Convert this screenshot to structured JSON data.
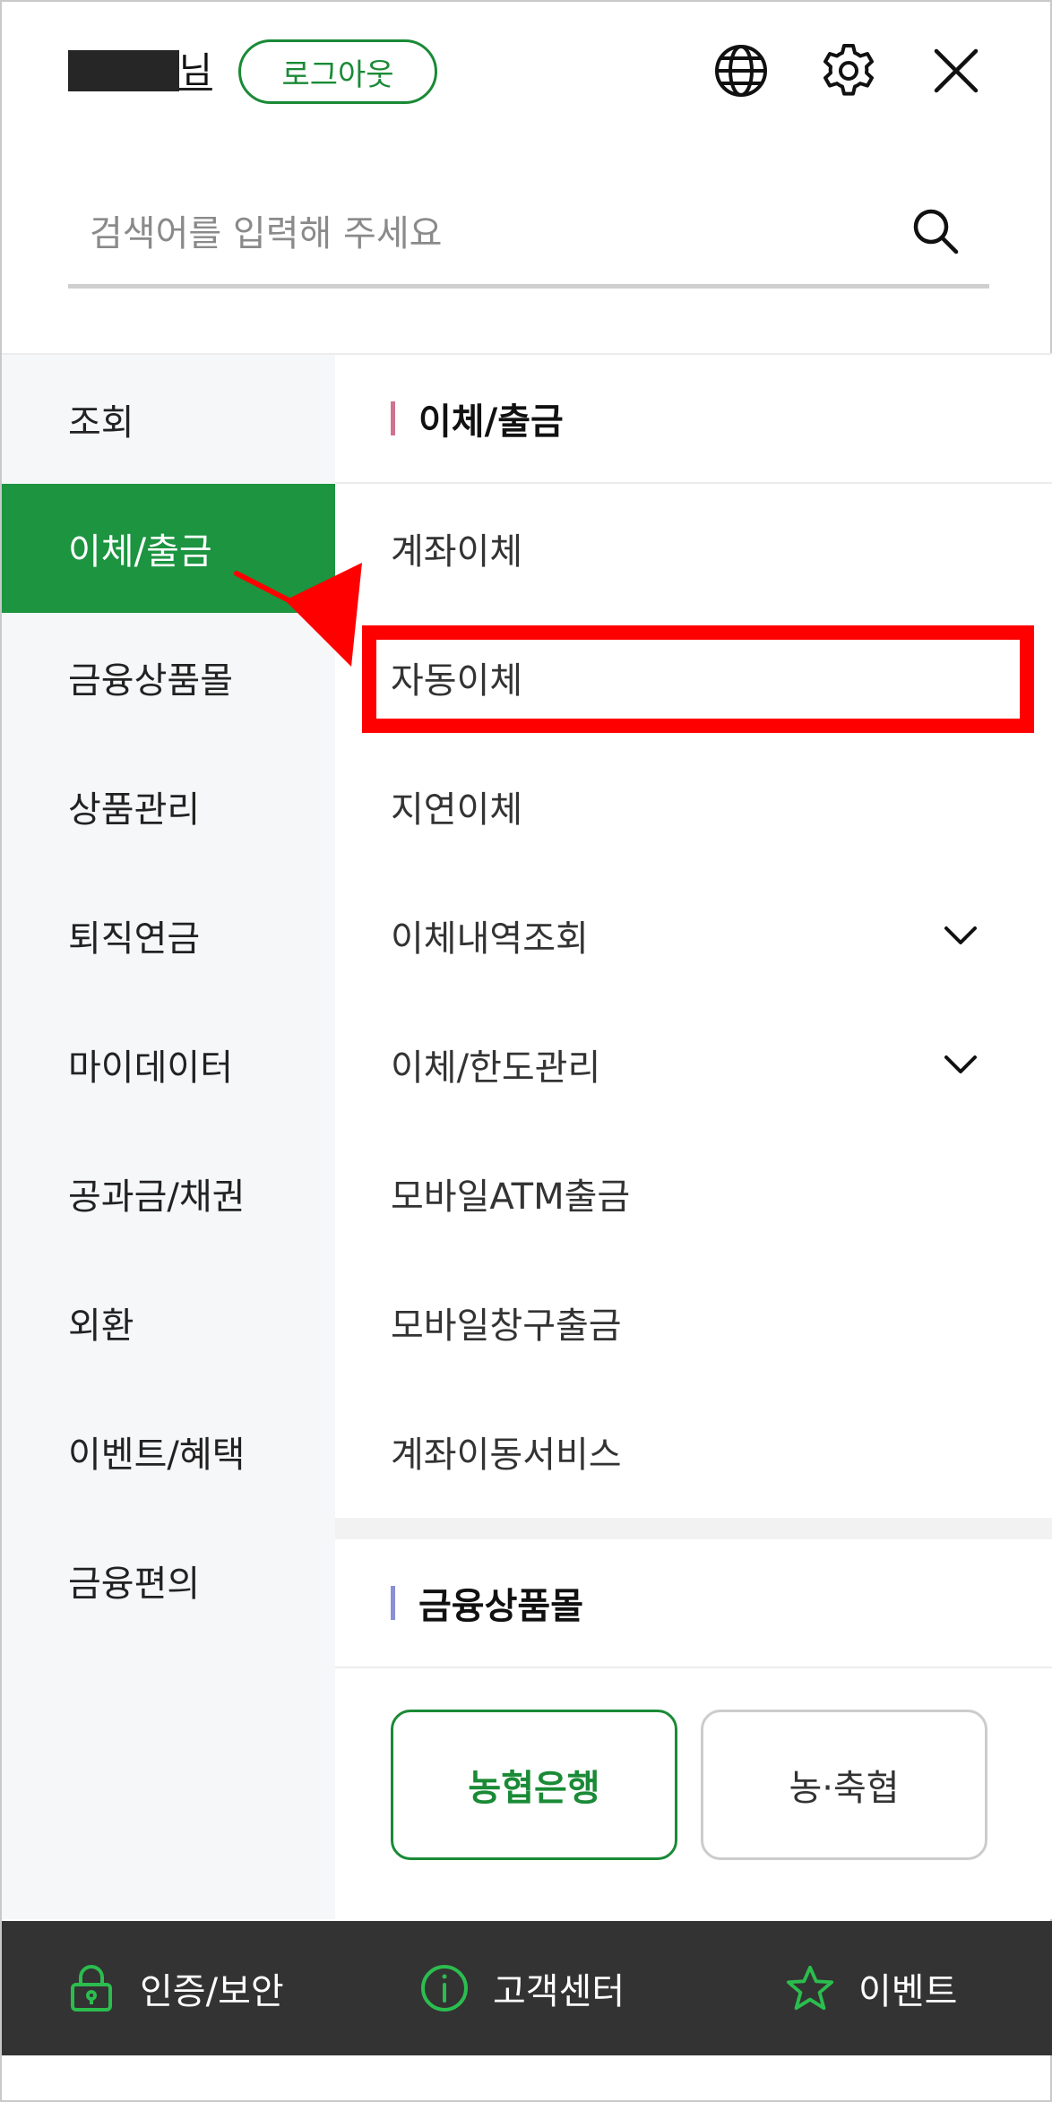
{
  "header": {
    "user_suffix": "님",
    "logout_label": "로그아웃",
    "icons": [
      "globe-icon",
      "gear-icon",
      "close-icon"
    ]
  },
  "search": {
    "placeholder": "검색어를 입력해 주세요"
  },
  "left_nav": {
    "items": [
      {
        "label": "조회",
        "active": false
      },
      {
        "label": "이체/출금",
        "active": true
      },
      {
        "label": "금융상품몰",
        "active": false
      },
      {
        "label": "상품관리",
        "active": false
      },
      {
        "label": "퇴직연금",
        "active": false
      },
      {
        "label": "마이데이터",
        "active": false
      },
      {
        "label": "공과금/채권",
        "active": false
      },
      {
        "label": "외환",
        "active": false
      },
      {
        "label": "이벤트/혜택",
        "active": false
      },
      {
        "label": "금융편의",
        "active": false
      }
    ]
  },
  "sections": {
    "transfer": {
      "title": "이체/출금",
      "bar_color": "#d0738f",
      "items": [
        {
          "label": "계좌이체",
          "expandable": false
        },
        {
          "label": "자동이체",
          "expandable": false,
          "highlighted": true
        },
        {
          "label": "지연이체",
          "expandable": false
        },
        {
          "label": "이체내역조회",
          "expandable": true
        },
        {
          "label": "이체/한도관리",
          "expandable": true
        },
        {
          "label": "모바일ATM출금",
          "expandable": false
        },
        {
          "label": "모바일창구출금",
          "expandable": false
        },
        {
          "label": "계좌이동서비스",
          "expandable": false
        }
      ]
    },
    "products": {
      "title": "금융상품몰",
      "bar_color": "#8a8fd6",
      "buttons": [
        {
          "label": "농협은행",
          "selected": true
        },
        {
          "label": "농·축협",
          "selected": false
        }
      ]
    }
  },
  "bottom_bar": {
    "items": [
      {
        "label": "인증/보안",
        "icon": "lock-icon"
      },
      {
        "label": "고객센터",
        "icon": "info-icon"
      },
      {
        "label": "이벤트",
        "icon": "star-icon"
      }
    ]
  },
  "colors": {
    "brand_green": "#1c9440",
    "highlight_red": "#ff0000",
    "bottom_bar_bg": "#333333"
  }
}
